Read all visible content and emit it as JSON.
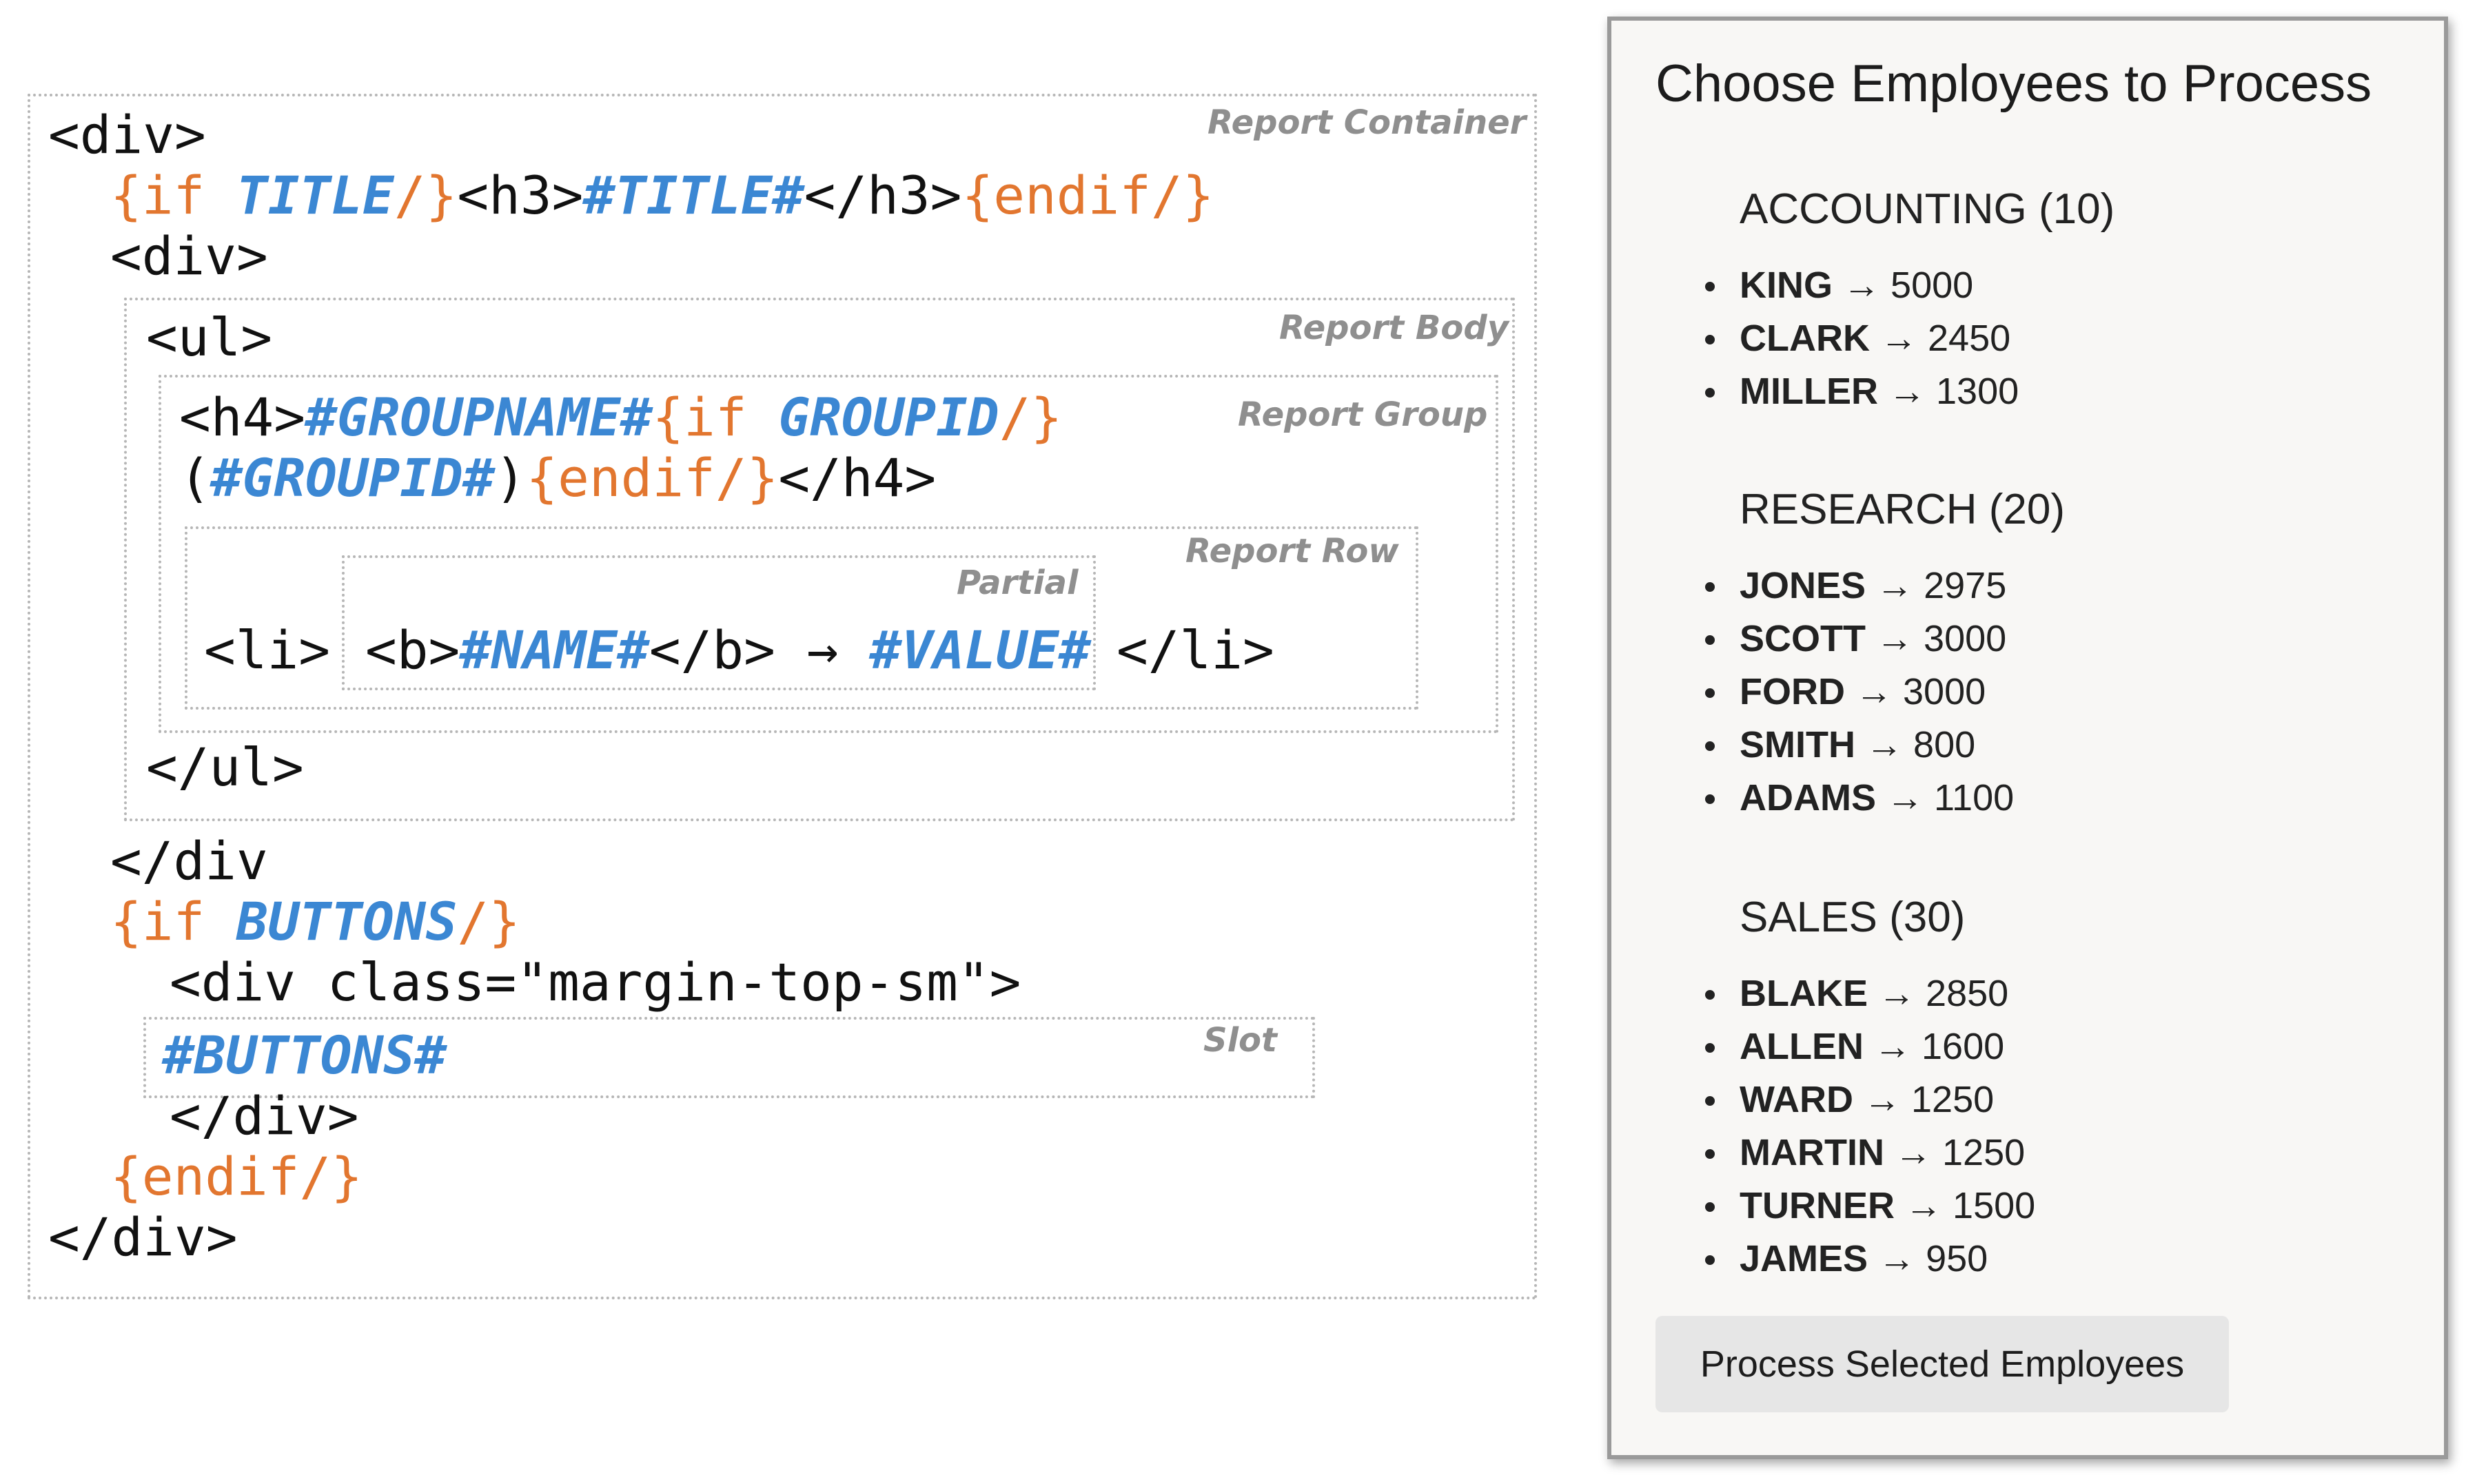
{
  "template": {
    "labels": {
      "container": "Report Container",
      "body": "Report Body",
      "group": "Report Group",
      "row": "Report Row",
      "partial": "Partial",
      "slot": "Slot"
    },
    "lines": [
      [
        {
          "t": "<div>"
        }
      ],
      [
        {
          "t": "{if ",
          "s": "k"
        },
        {
          "t": "TITLE",
          "s": "v"
        },
        {
          "t": "/}",
          "s": "k"
        },
        {
          "t": "<h3>"
        },
        {
          "t": "#TITLE#",
          "s": "v"
        },
        {
          "t": "</h3>"
        },
        {
          "t": "{endif/}",
          "s": "k"
        }
      ],
      [
        {
          "t": "<div>"
        }
      ],
      [
        {
          "t": "<ul>"
        }
      ],
      [
        {
          "t": "<h4>"
        },
        {
          "t": "#GROUPNAME#",
          "s": "v"
        },
        {
          "t": "{if ",
          "s": "k"
        },
        {
          "t": "GROUPID",
          "s": "v"
        },
        {
          "t": "/}",
          "s": "k"
        }
      ],
      [
        {
          "t": "("
        },
        {
          "t": "#GROUPID#",
          "s": "v"
        },
        {
          "t": ")"
        },
        {
          "t": "{endif/}",
          "s": "k"
        },
        {
          "t": "</h4>"
        }
      ],
      [
        {
          "t": "<li>"
        }
      ],
      [
        {
          "t": "<b>"
        },
        {
          "t": "#NAME#",
          "s": "v"
        },
        {
          "t": "</b> → "
        },
        {
          "t": "#VALUE#",
          "s": "v"
        }
      ],
      [
        {
          "t": "</li>"
        }
      ],
      [
        {
          "t": "</ul>"
        }
      ],
      [
        {
          "t": "</div"
        }
      ],
      [
        {
          "t": "{if ",
          "s": "k"
        },
        {
          "t": "BUTTONS",
          "s": "v"
        },
        {
          "t": "/}",
          "s": "k"
        }
      ],
      [
        {
          "t": "<div class=\"margin-top-sm\">"
        }
      ],
      [
        {
          "t": "#BUTTONS#",
          "s": "v"
        }
      ],
      [
        {
          "t": "</div>"
        }
      ],
      [
        {
          "t": "{endif/}",
          "s": "k"
        }
      ],
      [
        {
          "t": "</div>"
        }
      ]
    ]
  },
  "preview": {
    "title": "Choose Employees to Process",
    "groups": [
      {
        "heading": "ACCOUNTING (10)",
        "employees": [
          {
            "name": "KING",
            "value": "5000"
          },
          {
            "name": "CLARK",
            "value": "2450"
          },
          {
            "name": "MILLER",
            "value": "1300"
          }
        ]
      },
      {
        "heading": "RESEARCH (20)",
        "employees": [
          {
            "name": "JONES",
            "value": "2975"
          },
          {
            "name": "SCOTT",
            "value": "3000"
          },
          {
            "name": "FORD",
            "value": "3000"
          },
          {
            "name": "SMITH",
            "value": "800"
          },
          {
            "name": "ADAMS",
            "value": "1100"
          }
        ]
      },
      {
        "heading": "SALES (30)",
        "employees": [
          {
            "name": "BLAKE",
            "value": "2850"
          },
          {
            "name": "ALLEN",
            "value": "1600"
          },
          {
            "name": "WARD",
            "value": "1250"
          },
          {
            "name": "MARTIN",
            "value": "1250"
          },
          {
            "name": "TURNER",
            "value": "1500"
          },
          {
            "name": "JAMES",
            "value": "950"
          }
        ]
      }
    ],
    "arrow": "→",
    "button_label": "Process Selected Employees"
  }
}
